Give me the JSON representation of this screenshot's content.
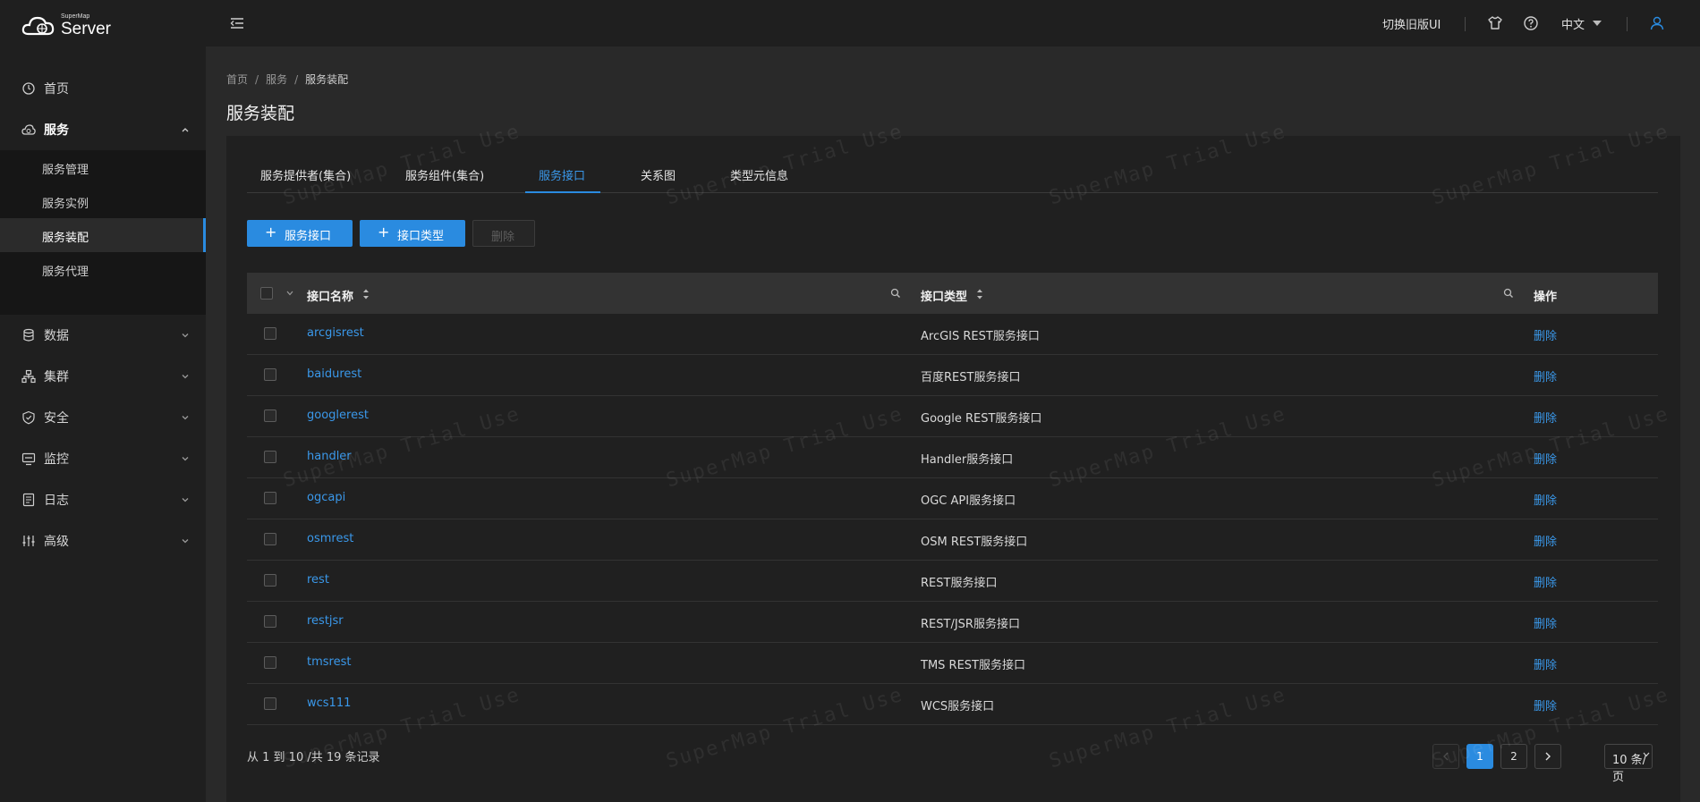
{
  "header": {
    "logo_small": "SuperMap",
    "logo_large": "Server",
    "old_ui_label": "切换旧版UI",
    "language": "中文",
    "icons": [
      "menu-collapse-icon",
      "shirt-icon",
      "help-circle-icon",
      "user-icon"
    ]
  },
  "sidebar": {
    "items": [
      {
        "label": "首页",
        "icon": "home-icon"
      },
      {
        "label": "服务",
        "icon": "cloud-icon",
        "expanded": true
      },
      {
        "label": "数据",
        "icon": "database-icon"
      },
      {
        "label": "集群",
        "icon": "cluster-icon"
      },
      {
        "label": "安全",
        "icon": "shield-icon"
      },
      {
        "label": "监控",
        "icon": "monitor-icon"
      },
      {
        "label": "日志",
        "icon": "log-icon"
      },
      {
        "label": "高级",
        "icon": "sliders-icon"
      }
    ],
    "sub_items": [
      {
        "label": "服务管理"
      },
      {
        "label": "服务实例"
      },
      {
        "label": "服务装配",
        "active": true
      },
      {
        "label": "服务代理"
      }
    ]
  },
  "breadcrumb": {
    "items": [
      "首页",
      "服务",
      "服务装配"
    ],
    "separator": "/"
  },
  "page_title": "服务装配",
  "tabs": [
    {
      "label": "服务提供者(集合)"
    },
    {
      "label": "服务组件(集合)"
    },
    {
      "label": "服务接口",
      "active": true
    },
    {
      "label": "关系图"
    },
    {
      "label": "类型元信息"
    }
  ],
  "toolbar": {
    "add_interface": "服务接口",
    "add_type": "接口类型",
    "delete": "删除"
  },
  "table": {
    "columns": {
      "name": "接口名称",
      "type": "接口类型",
      "action": "操作"
    },
    "rows": [
      {
        "name": "arcgisrest",
        "type": "ArcGIS REST服务接口",
        "action": "删除"
      },
      {
        "name": "baidurest",
        "type": "百度REST服务接口",
        "action": "删除"
      },
      {
        "name": "googlerest",
        "type": "Google REST服务接口",
        "action": "删除"
      },
      {
        "name": "handler",
        "type": "Handler服务接口",
        "action": "删除"
      },
      {
        "name": "ogcapi",
        "type": "OGC API服务接口",
        "action": "删除"
      },
      {
        "name": "osmrest",
        "type": "OSM REST服务接口",
        "action": "删除"
      },
      {
        "name": "rest",
        "type": "REST服务接口",
        "action": "删除"
      },
      {
        "name": "restjsr",
        "type": "REST/JSR服务接口",
        "action": "删除"
      },
      {
        "name": "tmsrest",
        "type": "TMS REST服务接口",
        "action": "删除"
      },
      {
        "name": "wcs111",
        "type": "WCS服务接口",
        "action": "删除"
      }
    ]
  },
  "pagination": {
    "summary": "从 1 到 10 /共 19 条记录",
    "pages": [
      "1",
      "2"
    ],
    "current_page": "1",
    "page_size": "10 条/页"
  },
  "watermark": "SuperMap Trial Use",
  "colors": {
    "accent": "#2a8be0",
    "link": "#3a98ea",
    "background": "#292929",
    "sidebar": "#1f1f1f"
  }
}
